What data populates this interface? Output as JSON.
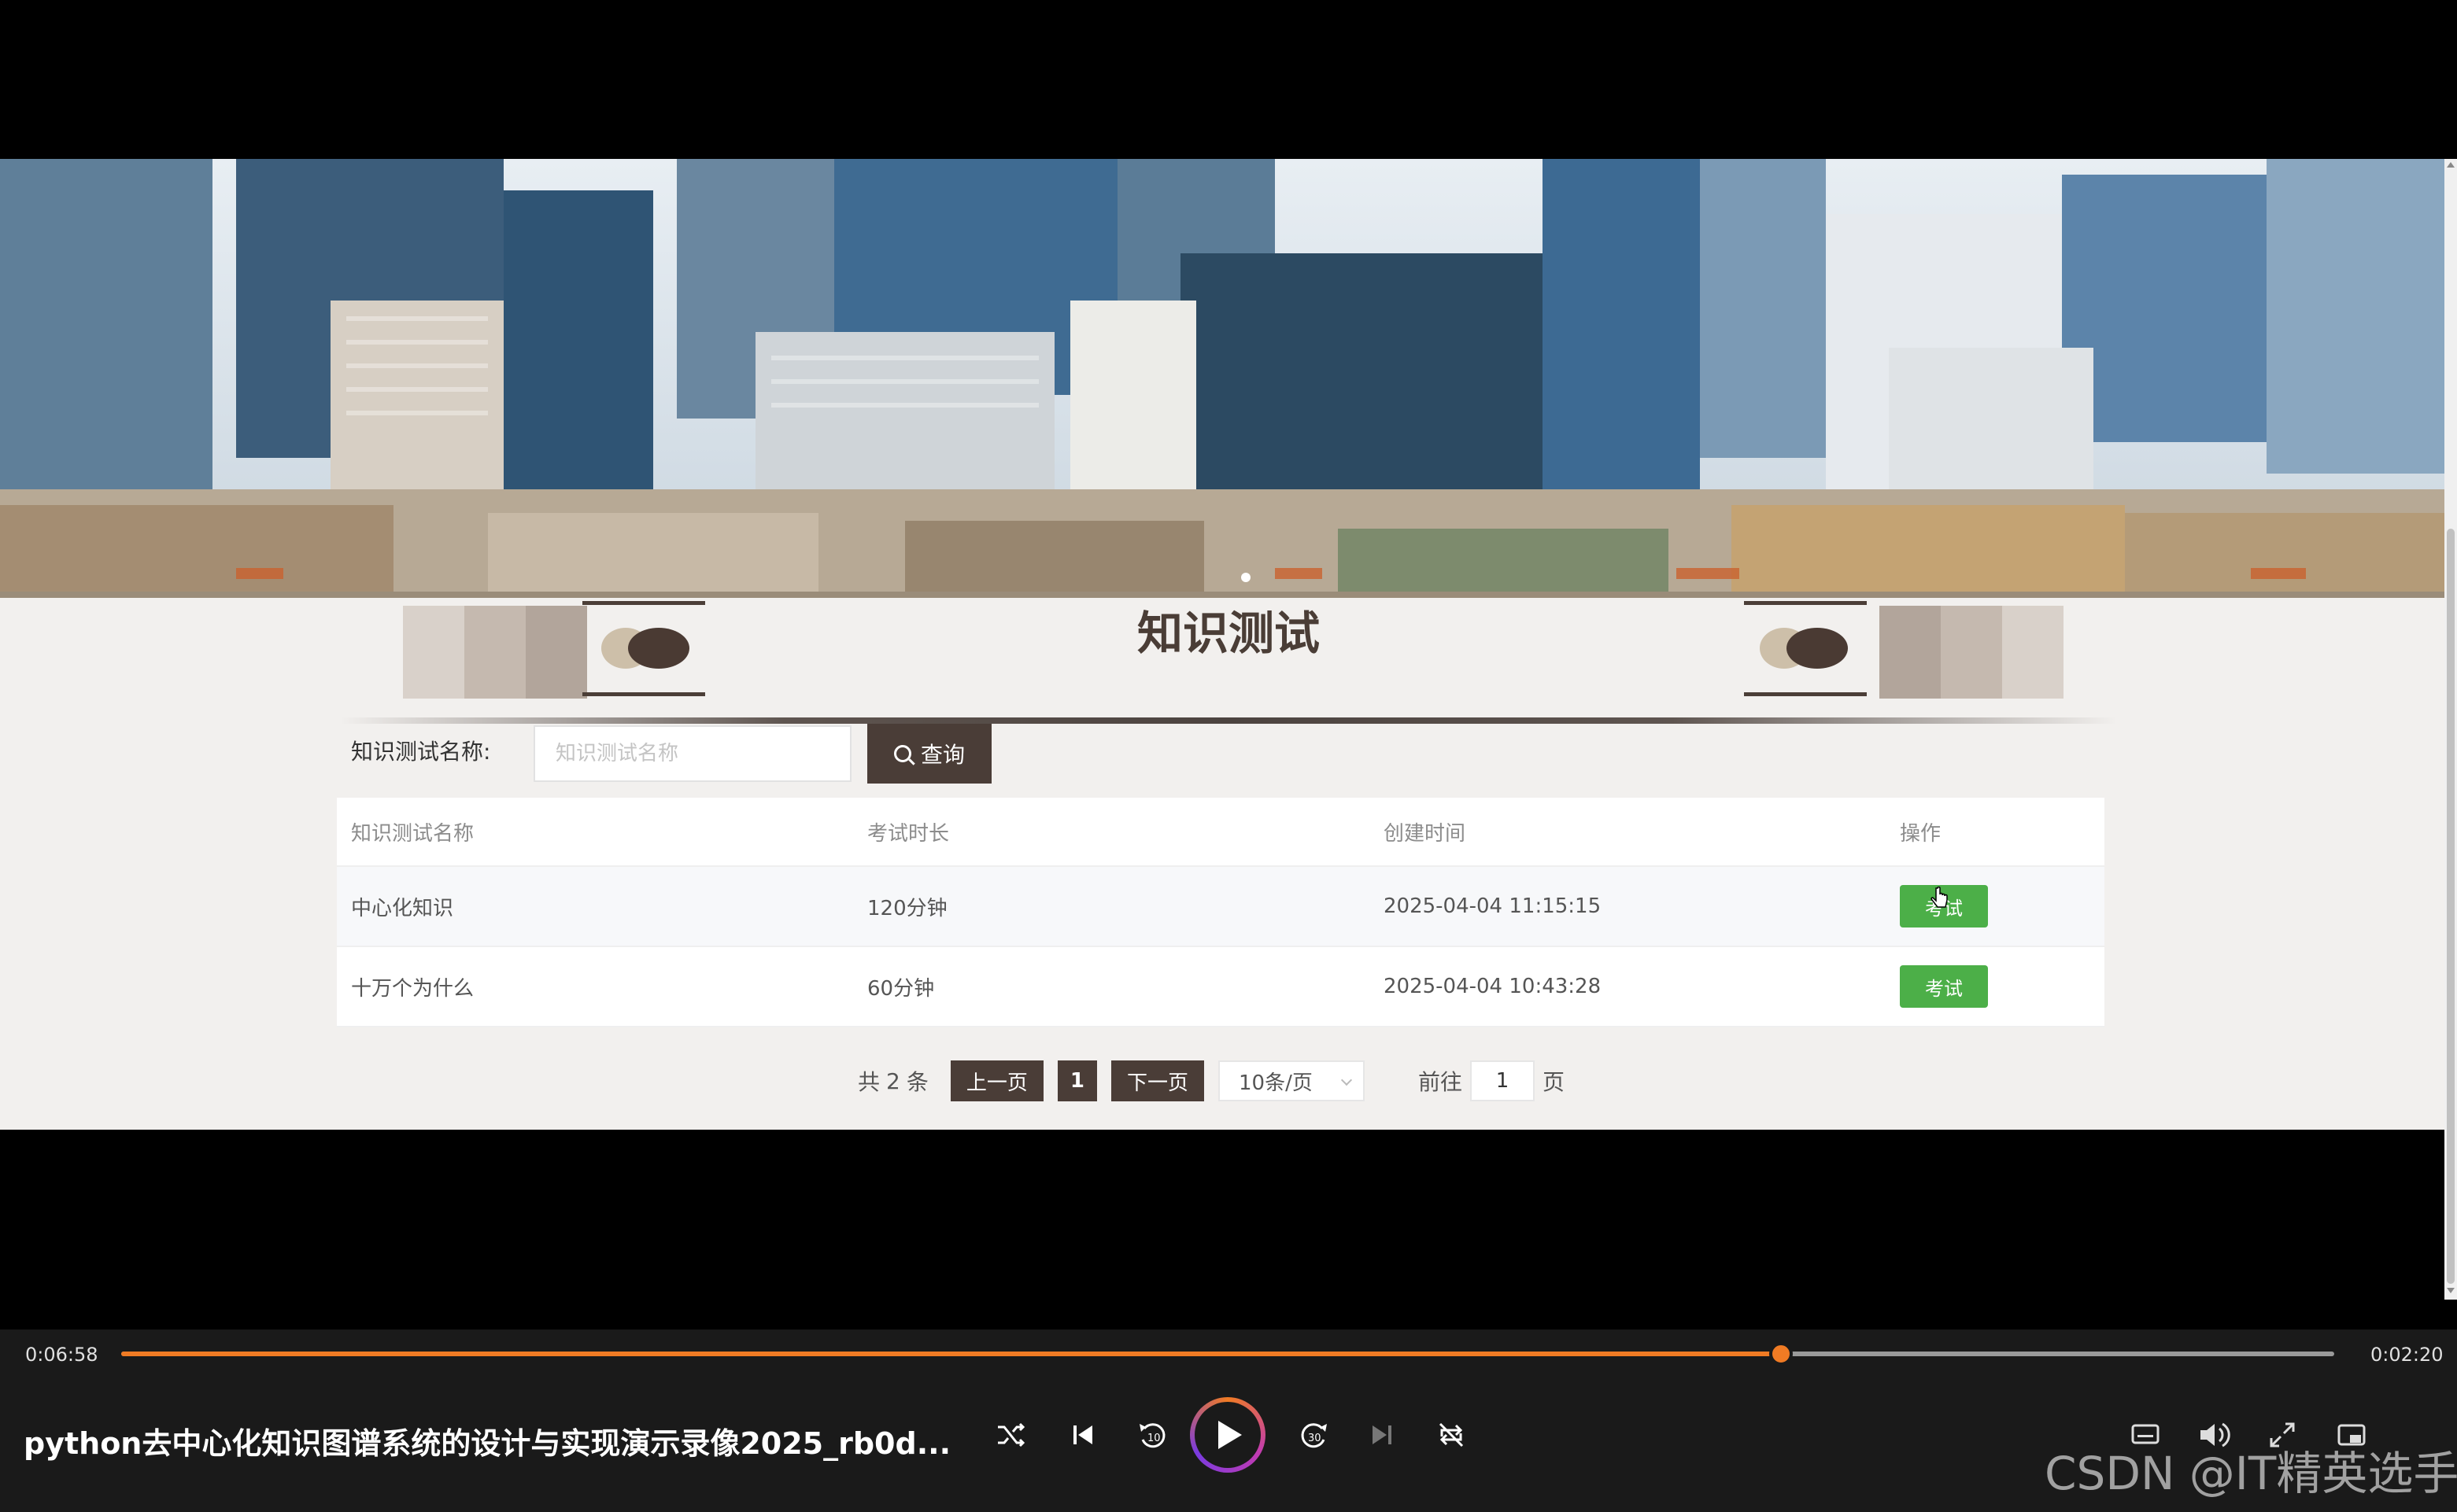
{
  "page": {
    "title": "知识测试",
    "search": {
      "label": "知识测试名称:",
      "placeholder": "知识测试名称",
      "value": "",
      "button_label": "查询",
      "button_icon": "search-icon"
    },
    "table": {
      "columns": [
        "知识测试名称",
        "考试时长",
        "创建时间",
        "操作"
      ],
      "rows": [
        {
          "name": "中心化知识",
          "duration": "120分钟",
          "created": "2025-04-04 11:15:15",
          "action": "考试"
        },
        {
          "name": "十万个为什么",
          "duration": "60分钟",
          "created": "2025-04-04 10:43:28",
          "action": "考试"
        }
      ]
    },
    "pagination": {
      "total_prefix": "共",
      "total": "2",
      "total_suffix": "条",
      "prev": "上一页",
      "current": "1",
      "next": "下一页",
      "page_size": "10条/页",
      "goto_prefix": "前往",
      "goto_value": "1",
      "goto_suffix": "页"
    },
    "colors": {
      "primary": "#4a3d37",
      "exam_button": "#4caf48",
      "background": "#f2f0ee"
    },
    "banner_carousel": {
      "slides": 1,
      "active": 1
    }
  },
  "player": {
    "current_time": "0:06:58",
    "total_time": "0:02:20",
    "progress_fraction": 0.75,
    "title": "python去中心化知识图谱系统的设计与实现演示录像2025_rb0d...",
    "accent": "#f07b24",
    "controls": [
      "shuffle-icon",
      "previous-icon",
      "rewind-10-icon",
      "play-icon",
      "forward-30-icon",
      "next-icon",
      "repeat-icon",
      "subtitles-icon",
      "volume-icon",
      "fullscreen-icon",
      "mini-player-icon"
    ],
    "watermark": "CSDN @IT精英选手"
  }
}
